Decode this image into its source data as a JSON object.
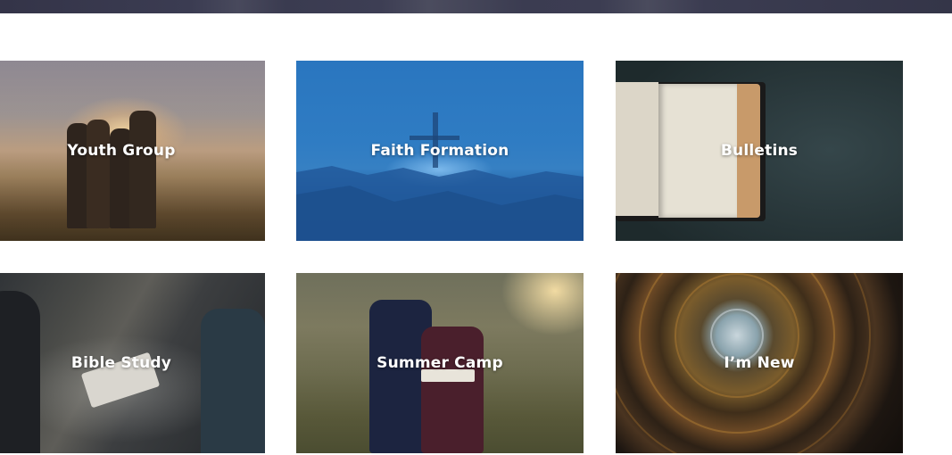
{
  "tiles": [
    {
      "id": "youth-group",
      "label": "Youth Group"
    },
    {
      "id": "faith-formation",
      "label": "Faith Formation"
    },
    {
      "id": "bulletins",
      "label": "Bulletins"
    },
    {
      "id": "bible-study",
      "label": "Bible Study"
    },
    {
      "id": "summer-camp",
      "label": "Summer Camp"
    },
    {
      "id": "im-new",
      "label": "I’m New"
    }
  ],
  "colors": {
    "banner": "#3b3c51",
    "label_text": "#ffffff",
    "faith_blue": "#2a76bf"
  }
}
